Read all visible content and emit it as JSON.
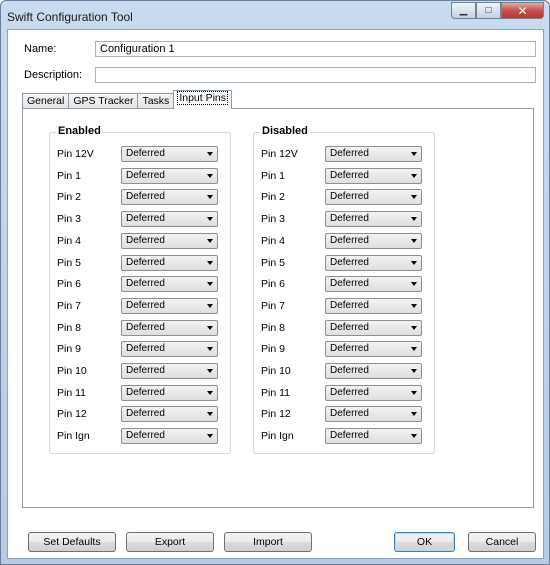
{
  "window": {
    "title": "Swift Configuration Tool",
    "minimize_glyph": "▁",
    "maximize_glyph": "□",
    "close_glyph": "✕"
  },
  "form": {
    "name_label": "Name:",
    "name_value": "Configuration 1",
    "description_label": "Description:",
    "description_value": ""
  },
  "tabs": [
    "General",
    "GPS Tracker",
    "Tasks",
    "Input Pins"
  ],
  "active_tab": "Input Pins",
  "enabled_group": {
    "title": "Enabled",
    "pins": [
      {
        "label": "Pin 12V",
        "value": "Deferred"
      },
      {
        "label": "Pin 1",
        "value": "Deferred"
      },
      {
        "label": "Pin 2",
        "value": "Deferred"
      },
      {
        "label": "Pin 3",
        "value": "Deferred"
      },
      {
        "label": "Pin 4",
        "value": "Deferred"
      },
      {
        "label": "Pin 5",
        "value": "Deferred"
      },
      {
        "label": "Pin 6",
        "value": "Deferred"
      },
      {
        "label": "Pin 7",
        "value": "Deferred"
      },
      {
        "label": "Pin 8",
        "value": "Deferred"
      },
      {
        "label": "Pin 9",
        "value": "Deferred"
      },
      {
        "label": "Pin 10",
        "value": "Deferred"
      },
      {
        "label": "Pin 11",
        "value": "Deferred"
      },
      {
        "label": "Pin 12",
        "value": "Deferred"
      },
      {
        "label": "Pin Ign",
        "value": "Deferred"
      }
    ]
  },
  "disabled_group": {
    "title": "Disabled",
    "pins": [
      {
        "label": "Pin 12V",
        "value": "Deferred"
      },
      {
        "label": "Pin 1",
        "value": "Deferred"
      },
      {
        "label": "Pin 2",
        "value": "Deferred"
      },
      {
        "label": "Pin 3",
        "value": "Deferred"
      },
      {
        "label": "Pin 4",
        "value": "Deferred"
      },
      {
        "label": "Pin 5",
        "value": "Deferred"
      },
      {
        "label": "Pin 6",
        "value": "Deferred"
      },
      {
        "label": "Pin 7",
        "value": "Deferred"
      },
      {
        "label": "Pin 8",
        "value": "Deferred"
      },
      {
        "label": "Pin 9",
        "value": "Deferred"
      },
      {
        "label": "Pin 10",
        "value": "Deferred"
      },
      {
        "label": "Pin 11",
        "value": "Deferred"
      },
      {
        "label": "Pin 12",
        "value": "Deferred"
      },
      {
        "label": "Pin Ign",
        "value": "Deferred"
      }
    ]
  },
  "buttons": {
    "set_defaults": "Set Defaults",
    "export": "Export",
    "import": "Import",
    "ok": "OK",
    "cancel": "Cancel"
  }
}
